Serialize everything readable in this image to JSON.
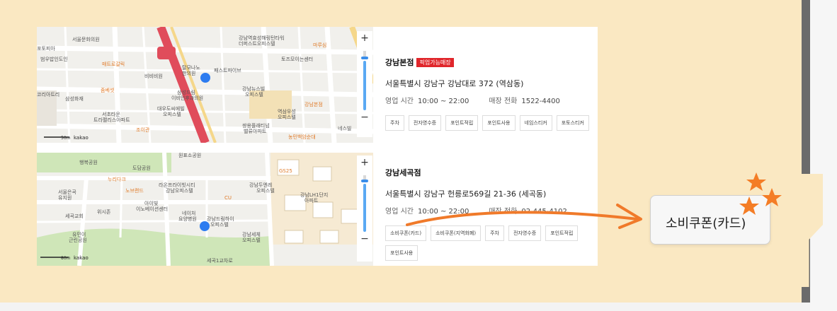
{
  "stores": [
    {
      "name": "강남본점",
      "badge": "픽업가능매장",
      "address": "서울특별시 강남구 강남대로 372 (역삼동)",
      "hours_label": "영업 시간",
      "hours": "10:00 ~ 22:00",
      "phone_label": "매장 전화",
      "phone": "1522-4400",
      "tags": [
        "주차",
        "전자영수증",
        "포인트적립",
        "포인트사용",
        "네임스티커",
        "포토스티커"
      ],
      "map": {
        "scale": "50m",
        "brand": "kakao",
        "labels": [
          "세븐일레븐",
          "서울문화의원",
          "포토피아",
          "범우밥인도인",
          "매트로갈릭",
          "비비비원",
          "탈모나노",
          "한의원",
          "패스트파이브",
          "코리아트리빌딩",
          "삼성화재",
          "본사",
          "서초타운",
          "트라팰리스아파트",
          "대우도씨에빌",
          "오피스텔",
          "조이관",
          "삼성드림",
          "이비인후과의원",
          "강남뉴스빌",
          "오피스텔",
          "역삼우성",
          "오피스텔",
          "쌍용플래티넘",
          "밸류아파트",
          "역삼동",
          "현대해상",
          "강남본점",
          "토즈모이는센터",
          "강남역효성해링턴타워",
          "더퍼스트오피스텔",
          "마루심",
          "교보생명",
          "농민백암순대",
          "네스빌",
          "홍콜렉션중선소"
        ]
      }
    },
    {
      "name": "강남세곡점",
      "address": "서울특별시 강남구 헌릉로569길 21-36 (세곡동)",
      "hours_label": "영업 시간",
      "hours": "10:00 ~ 22:00",
      "phone_label": "매장 전화",
      "phone": "02-445-4102",
      "tags": [
        "소비쿠폰(카드)",
        "소비쿠폰(지역화폐)",
        "주차",
        "전자영수증",
        "포인트적립",
        "포인트사용"
      ],
      "map": {
        "scale": "80m",
        "brand": "kakao",
        "labels": [
          "원표소공원",
          "행복공원",
          "도담공원",
          "누리다크",
          "노브랜드",
          "라온프라이빗시티",
          "강남오피스텔",
          "강남두엔레",
          "오피스텔",
          "서울은곡",
          "유지원",
          "세곡교회",
          "위시존",
          "아이빛",
          "이노베이션센터",
          "네이처",
          "요양병원",
          "강남드림하이",
          "오피스텔",
          "강남LH1단지",
          "아파트",
          "강남세체",
          "오피스텔",
          "유민이",
          "근린공원",
          "세곡1교차로",
          "GS25",
          "CU"
        ]
      }
    }
  ],
  "zoom": {
    "plus": "+",
    "minus": "−"
  },
  "callout": {
    "label": "소비쿠폰(카드)"
  },
  "colors": {
    "accent_arrow": "#f07a2a",
    "star": "#f47d26",
    "badge": "#e0262b",
    "beige": "#fae8c2"
  }
}
